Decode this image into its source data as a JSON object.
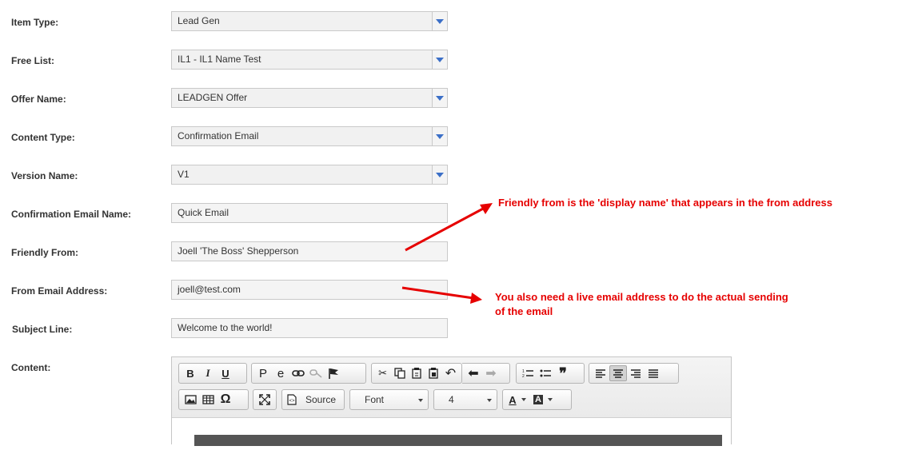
{
  "form": {
    "item_type": {
      "label": "Item Type:",
      "value": "Lead Gen"
    },
    "free_list": {
      "label": "Free List:",
      "value": "IL1 - IL1 Name Test"
    },
    "offer_name": {
      "label": "Offer Name:",
      "value": "LEADGEN Offer"
    },
    "content_type": {
      "label": "Content Type:",
      "value": "Confirmation Email"
    },
    "version_name": {
      "label": "Version Name:",
      "value": "V1"
    },
    "confirmation_email_name": {
      "label": "Confirmation Email Name:",
      "value": "Quick Email"
    },
    "friendly_from": {
      "label": "Friendly From:",
      "value": "Joell 'The Boss' Shepperson"
    },
    "from_email": {
      "label": "From Email Address:",
      "value": "joell@test.com"
    },
    "subject_line": {
      "label": "Subject Line:",
      "value": "Welcome to the world!"
    },
    "content": {
      "label": "Content:"
    }
  },
  "annotations": {
    "friendly_from_note": "Friendly from is the 'display name' that appears in the from address",
    "email_note_line1": "You also need a live email address to do the actual sending",
    "email_note_line2": "of the email"
  },
  "editor": {
    "source_label": "Source",
    "font_label": "Font",
    "size_label": "4",
    "bold_glyph": "B",
    "italic_glyph": "I",
    "underline_glyph": "U",
    "paragraph_glyph": "P",
    "omega_glyph": "Ω",
    "quote_glyph": "❞",
    "text_color_glyph": "A",
    "bg_color_glyph": "A"
  },
  "colors": {
    "annotation": "#e60000",
    "dropdown_arrow": "#3b6fc7"
  }
}
